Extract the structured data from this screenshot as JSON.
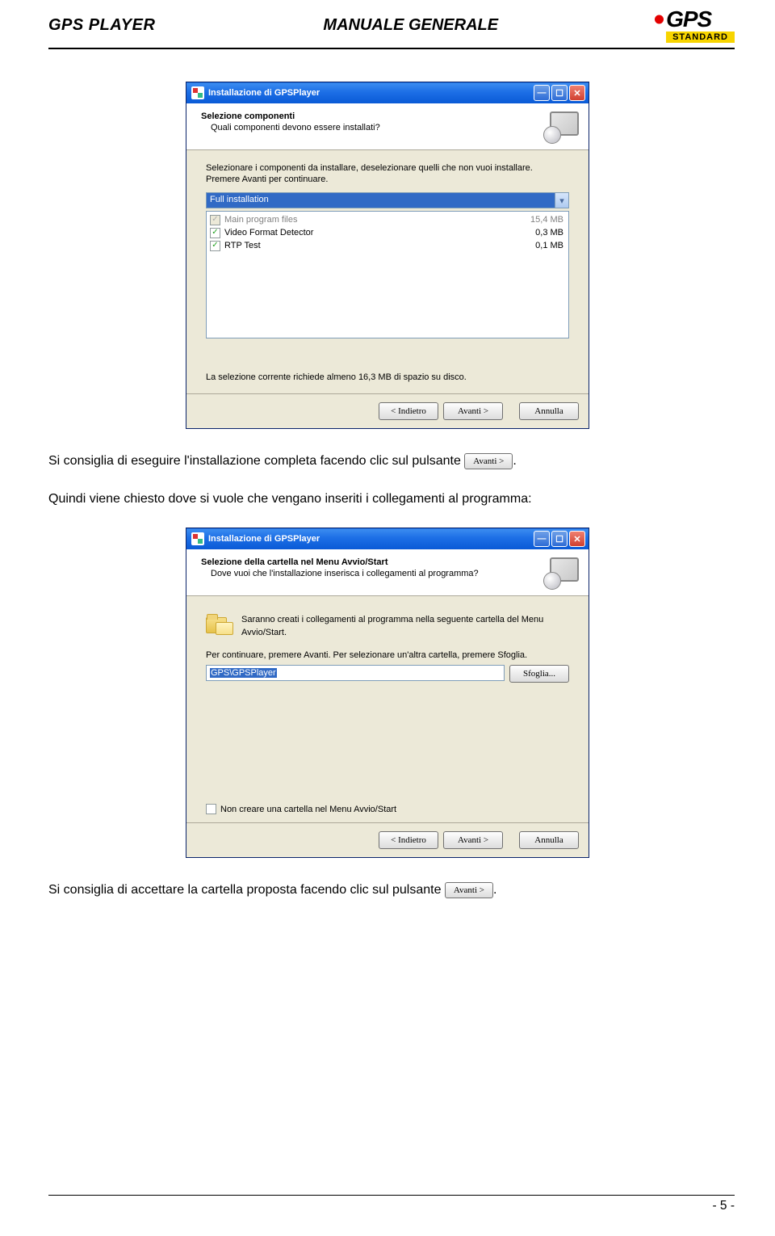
{
  "header": {
    "left": "GPS PLAYER",
    "center": "MANUALE GENERALE",
    "logo_top": "GPS",
    "logo_bottom": "STANDARD"
  },
  "dialog1": {
    "title": "Installazione di GPSPlayer",
    "wiz_title": "Selezione componenti",
    "wiz_sub": "Quali componenti devono essere installati?",
    "instr1": "Selezionare i componenti da installare, deselezionare quelli che non vuoi installare.",
    "instr2": "Premere Avanti per continuare.",
    "dropdown": "Full installation",
    "rows": [
      {
        "label": "Main program files",
        "size": "15,4 MB",
        "checked": true,
        "disabled": true
      },
      {
        "label": "Video Format Detector",
        "size": "0,3 MB",
        "checked": true,
        "disabled": false
      },
      {
        "label": "RTP Test",
        "size": "0,1 MB",
        "checked": true,
        "disabled": false
      }
    ],
    "space": "La selezione corrente richiede almeno 16,3 MB di spazio su disco.",
    "back": "< Indietro",
    "next": "Avanti >",
    "cancel": "Annulla"
  },
  "para1_a": "Si consiglia di eseguire l'installazione completa facendo clic sul pulsante ",
  "para1_b": ".",
  "para2": "Quindi viene chiesto dove si vuole che vengano inseriti i collegamenti al programma:",
  "dialog2": {
    "title": "Installazione di GPSPlayer",
    "wiz_title": "Selezione della cartella nel Menu Avvio/Start",
    "wiz_sub": "Dove vuoi che l'installazione inserisca i collegamenti al programma?",
    "info": "Saranno creati i collegamenti al programma nella seguente cartella del Menu Avvio/Start.",
    "cont": "Per continuare, premere Avanti. Per selezionare un'altra cartella, premere Sfoglia.",
    "path": "GPS\\GPSPlayer",
    "browse": "Sfoglia...",
    "nocreate": "Non creare una cartella nel Menu Avvio/Start",
    "back": "< Indietro",
    "next": "Avanti >",
    "cancel": "Annulla"
  },
  "para3_a": "Si consiglia di accettare la cartella proposta facendo clic sul pulsante ",
  "para3_b": ".",
  "inline_btn": "Avanti >",
  "pagenum": "- 5 -"
}
